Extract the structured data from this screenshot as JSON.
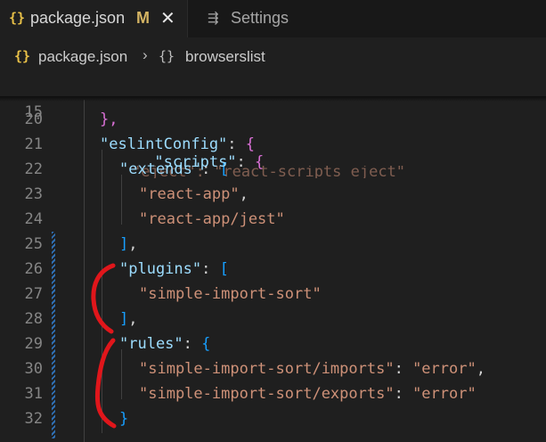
{
  "tabs": [
    {
      "label": "package.json",
      "status": "M",
      "close": "✕",
      "icon": "json-braces-icon",
      "icon_glyph": "{}"
    },
    {
      "label": "Settings",
      "icon": "settings-icon",
      "icon_glyph": "⇶"
    }
  ],
  "breadcrumb": {
    "file_icon_glyph": "{}",
    "file": "package.json",
    "separator": "›",
    "symbol_icon_glyph": "{}",
    "symbol": "browserslist"
  },
  "editor": {
    "sticky_line": {
      "number": "15",
      "key": "\"scripts\"",
      "colon": ": ",
      "brace": "{"
    },
    "ghost_text": "\"eject\": \"react-scripts eject\"",
    "lines": [
      {
        "number": "20",
        "tokens": [
          {
            "t": "},",
            "c": "b2"
          }
        ]
      },
      {
        "number": "21",
        "tokens": [
          {
            "t": "\"eslintConfig\"",
            "c": "k"
          },
          {
            "t": ": ",
            "c": "p"
          },
          {
            "t": "{",
            "c": "b2"
          }
        ]
      },
      {
        "number": "22",
        "tokens": [
          {
            "t": "\"extends\"",
            "c": "k"
          },
          {
            "t": ": ",
            "c": "p"
          },
          {
            "t": "[",
            "c": "b3"
          }
        ]
      },
      {
        "number": "23",
        "tokens": [
          {
            "t": "\"react-app\"",
            "c": "s"
          },
          {
            "t": ",",
            "c": "p"
          }
        ]
      },
      {
        "number": "24",
        "tokens": [
          {
            "t": "\"react-app/jest\"",
            "c": "s"
          }
        ]
      },
      {
        "number": "25",
        "tokens": [
          {
            "t": "]",
            "c": "b3"
          },
          {
            "t": ",",
            "c": "p"
          }
        ]
      },
      {
        "number": "26",
        "tokens": [
          {
            "t": "\"plugins\"",
            "c": "k"
          },
          {
            "t": ": ",
            "c": "p"
          },
          {
            "t": "[",
            "c": "b3"
          }
        ]
      },
      {
        "number": "27",
        "tokens": [
          {
            "t": "\"simple-import-sort\"",
            "c": "s"
          }
        ]
      },
      {
        "number": "28",
        "tokens": [
          {
            "t": "]",
            "c": "b3"
          },
          {
            "t": ",",
            "c": "p"
          }
        ]
      },
      {
        "number": "29",
        "tokens": [
          {
            "t": "\"rules\"",
            "c": "k"
          },
          {
            "t": ": ",
            "c": "p"
          },
          {
            "t": "{",
            "c": "b3"
          }
        ]
      },
      {
        "number": "30",
        "tokens": [
          {
            "t": "\"simple-import-sort/imports\"",
            "c": "s"
          },
          {
            "t": ": ",
            "c": "p"
          },
          {
            "t": "\"error\"",
            "c": "s"
          },
          {
            "t": ",",
            "c": "p"
          }
        ]
      },
      {
        "number": "31",
        "tokens": [
          {
            "t": "\"simple-import-sort/exports\"",
            "c": "s"
          },
          {
            "t": ": ",
            "c": "p"
          },
          {
            "t": "\"error\"",
            "c": "s"
          }
        ]
      },
      {
        "number": "32",
        "tokens": [
          {
            "t": "}",
            "c": "b3"
          }
        ]
      }
    ]
  },
  "colors": {
    "background": "#1f1f1f",
    "key": "#9cdcfe",
    "string": "#ce9178",
    "bracket_gold": "#ffd700",
    "bracket_purple": "#da70d6",
    "bracket_blue": "#179fff",
    "annotation": "#e0161b"
  },
  "annotations": [
    "red-bracket-around-plugins",
    "red-bracket-around-rules"
  ]
}
